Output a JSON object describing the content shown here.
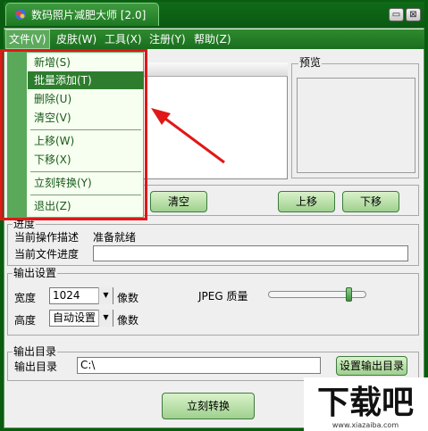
{
  "window": {
    "title": "数码照片减肥大师 [2.0]",
    "minimize_glyph": "▭",
    "close_glyph": "⊠"
  },
  "menubar": [
    {
      "label": "文件(V)"
    },
    {
      "label": "皮肤(W)"
    },
    {
      "label": "工具(X)"
    },
    {
      "label": "注册(Y)"
    },
    {
      "label": "帮助(Z)"
    }
  ],
  "file_menu": {
    "items": [
      {
        "label": "新增(S)"
      },
      {
        "label": "批量添加(T)",
        "selected": true
      },
      {
        "label": "删除(U)"
      },
      {
        "label": "清空(V)"
      },
      {
        "label": "上移(W)"
      },
      {
        "label": "下移(X)"
      },
      {
        "label": "立刻转换(Y)"
      },
      {
        "label": "退出(Z)"
      }
    ]
  },
  "preview": {
    "label": "预览"
  },
  "list_buttons": {
    "clear": "清空",
    "up": "上移",
    "down": "下移"
  },
  "progress": {
    "group_label": "进度",
    "op_label": "当前操作描述",
    "op_value": "准备就绪",
    "file_label": "当前文件进度",
    "file_value": ""
  },
  "output_settings": {
    "group_label": "输出设置",
    "width_label": "宽度",
    "width_value": "1024",
    "height_label": "高度",
    "height_value": "自动设置",
    "unit": "像数",
    "jpeg_label": "JPEG 质量",
    "jpeg_quality_fraction": 0.85
  },
  "output_dir": {
    "group_label": "输出目录",
    "label": "输出目录",
    "value": "C:\\",
    "button": "设置输出目录"
  },
  "convert_button": "立刻转换",
  "watermark": {
    "text": "下载吧",
    "subtext": "www.xiazaiba.com"
  },
  "colors": {
    "accent_green": "#1a6e1e",
    "highlight_red": "#e01818"
  },
  "icons": [
    "app-icon",
    "minimize-icon",
    "close-icon",
    "combo-arrow-icon",
    "annotation-arrow"
  ]
}
